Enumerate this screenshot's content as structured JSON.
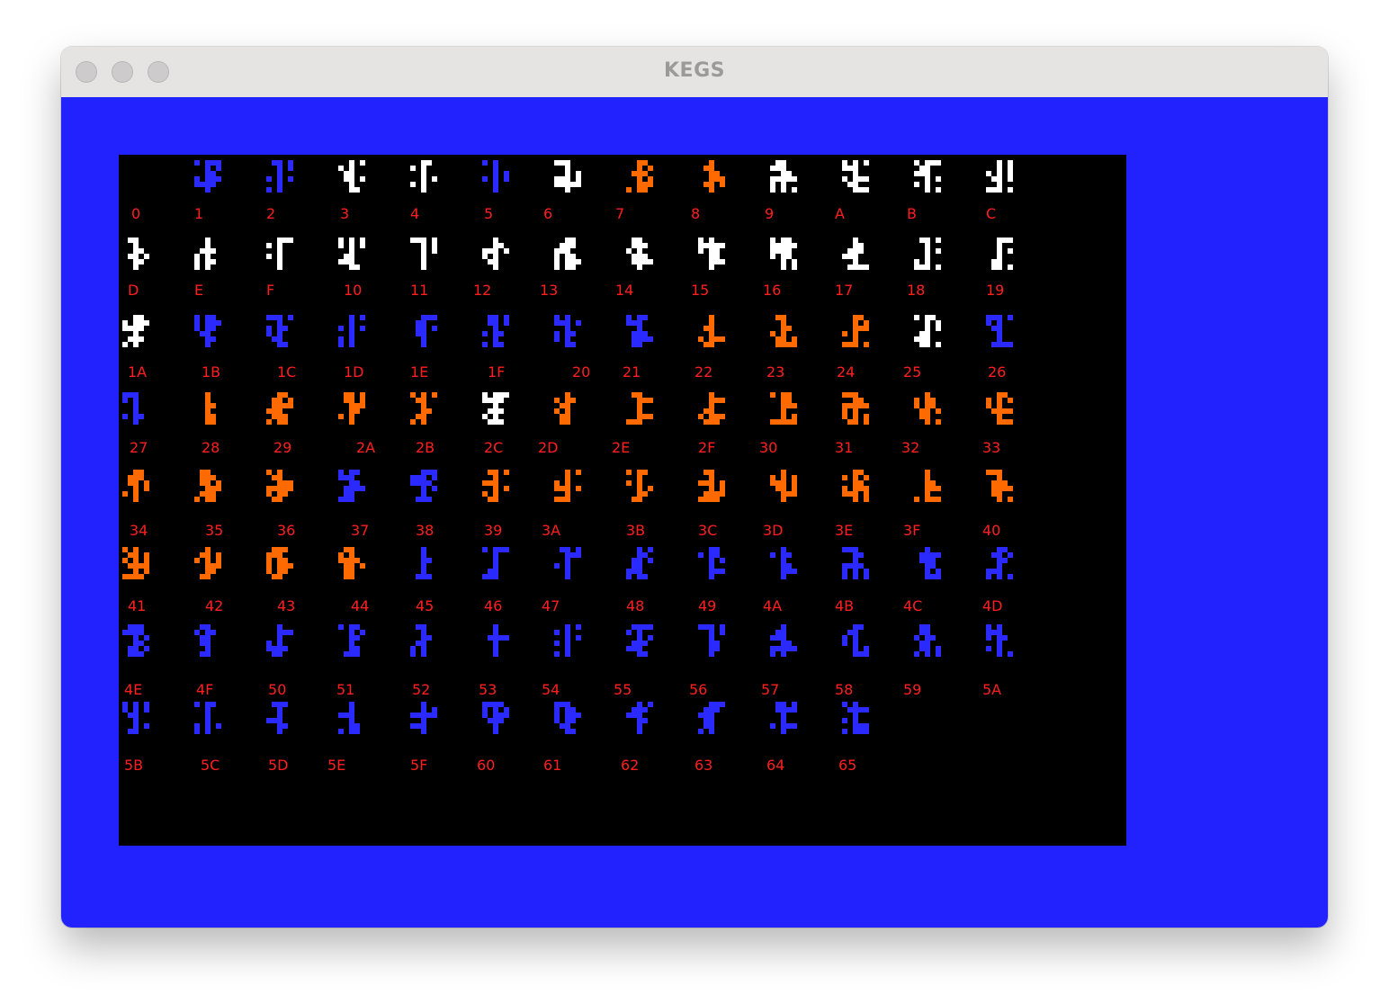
{
  "window": {
    "title": "KEGS"
  },
  "colors": {
    "border": "#2222ff",
    "screen": "#000000",
    "label": "#ff1f1f",
    "sprite_white": "#ffffff",
    "sprite_orange": "#ff6a00",
    "sprite_blue": "#2a2aff"
  },
  "shape_table": {
    "labels": [
      [
        "0",
        "1",
        "2",
        "3",
        "4",
        "5",
        "6",
        "7",
        "8",
        "9",
        "A",
        "B",
        "C"
      ],
      [
        "D",
        "E",
        "F",
        "10",
        "11",
        "12",
        "13",
        "14",
        "15",
        "16",
        "17",
        "18",
        "19"
      ],
      [
        "1A",
        "1B",
        "1C",
        "1D",
        "1E",
        "1F",
        "20",
        "21",
        "22",
        "23",
        "24",
        "25",
        "26"
      ],
      [
        "27",
        "28",
        "29",
        "2A",
        "2B",
        "2C",
        "2D",
        "2E",
        "2F",
        "30",
        "31",
        "32",
        "33"
      ],
      [
        "34",
        "35",
        "36",
        "37",
        "38",
        "39",
        "3A",
        "3B",
        "3C",
        "3D",
        "3E",
        "3F",
        "40"
      ],
      [
        "41",
        "42",
        "43",
        "44",
        "45",
        "46",
        "47",
        "48",
        "49",
        "4A",
        "4B",
        "4C",
        "4D"
      ],
      [
        "4E",
        "4F",
        "50",
        "51",
        "52",
        "53",
        "54",
        "55",
        "56",
        "57",
        "58",
        "59",
        "5A"
      ],
      [
        "5B",
        "5C",
        "5D",
        "5E",
        "5F",
        "60",
        "61",
        "62",
        "63",
        "64",
        "65"
      ]
    ],
    "sprite_colors": [
      [
        "none",
        "blue",
        "blue",
        "white",
        "white",
        "blue",
        "white",
        "orange",
        "orange",
        "white",
        "white",
        "white",
        "white"
      ],
      [
        "white",
        "white",
        "white",
        "white",
        "white",
        "white",
        "white",
        "white",
        "white",
        "white",
        "white",
        "white",
        "white"
      ],
      [
        "white",
        "blue",
        "blue",
        "blue",
        "blue",
        "blue",
        "blue",
        "blue",
        "orange",
        "orange",
        "orange",
        "white",
        "blue"
      ],
      [
        "blue",
        "orange",
        "orange",
        "orange",
        "orange",
        "white",
        "orange",
        "orange",
        "orange",
        "orange",
        "orange",
        "orange",
        "orange"
      ],
      [
        "orange",
        "orange",
        "orange",
        "blue",
        "blue",
        "orange",
        "orange",
        "orange",
        "orange",
        "orange",
        "orange",
        "orange",
        "orange"
      ],
      [
        "orange",
        "orange",
        "orange",
        "orange",
        "blue",
        "blue",
        "blue",
        "blue",
        "blue",
        "blue",
        "blue",
        "blue",
        "blue"
      ],
      [
        "blue",
        "blue",
        "blue",
        "blue",
        "blue",
        "blue",
        "blue",
        "blue",
        "blue",
        "blue",
        "blue",
        "blue",
        "blue"
      ],
      [
        "blue",
        "blue",
        "blue",
        "blue",
        "blue",
        "blue",
        "blue",
        "blue",
        "blue",
        "blue",
        "blue"
      ]
    ]
  }
}
